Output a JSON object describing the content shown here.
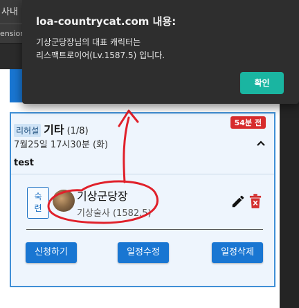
{
  "browser": {
    "tab_label": "사내",
    "extension_label": "ension"
  },
  "card": {
    "tag": "리허설",
    "title": "기타",
    "count": "(1/8)",
    "time_badge": "54분 전",
    "date": "7월25일 17시30분 (화)",
    "description": "test",
    "member": {
      "role": "숙련",
      "name": "기상군당장",
      "class_level": "기상술사 (1582.5)"
    },
    "buttons": {
      "apply": "신청하기",
      "edit_schedule": "일정수정",
      "delete_schedule": "일정삭제"
    }
  },
  "dialog": {
    "title": "loa-countrycat.com 내용:",
    "message_line1": "기상군당장님의 대표 캐릭터는",
    "message_line2": "리스팩트로이어(Lv.1587.5) 입니다.",
    "ok_label": "확인"
  },
  "colors": {
    "primary": "#1976d2",
    "badge": "#d72c2c",
    "dialog_ok": "#1ab5a1",
    "annotation": "#e0202a"
  },
  "icons": [
    "chevron-up-icon",
    "pencil-icon",
    "trash-icon"
  ]
}
